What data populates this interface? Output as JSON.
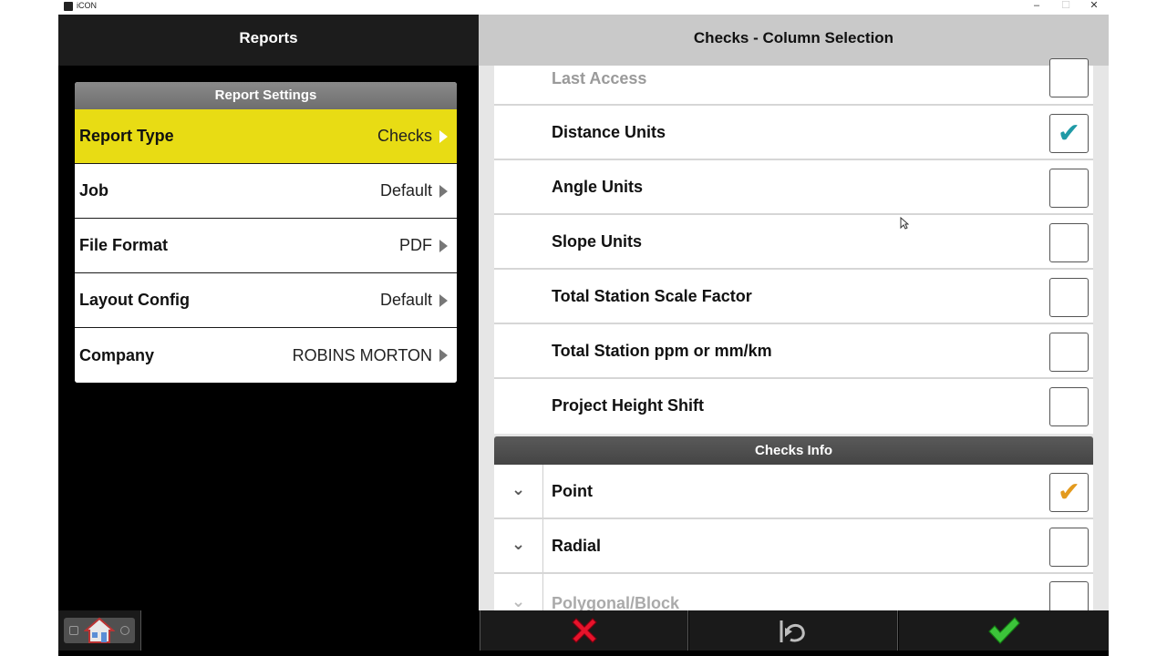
{
  "window": {
    "title": "iCON",
    "minimize": "–",
    "maximize": "☐",
    "close": "✕"
  },
  "left": {
    "header": "Reports",
    "settings_title": "Report Settings",
    "rows": [
      {
        "label": "Report Type",
        "value": "Checks",
        "active": true
      },
      {
        "label": "Job",
        "value": "Default",
        "active": false
      },
      {
        "label": "File Format",
        "value": "PDF",
        "active": false
      },
      {
        "label": "Layout Config",
        "value": "Default",
        "active": false
      },
      {
        "label": "Company",
        "value": "ROBINS MORTON",
        "active": false
      }
    ]
  },
  "right": {
    "header": "Checks - Column Selection",
    "columns": [
      {
        "label": "Last Access",
        "checked": false
      },
      {
        "label": "Distance Units",
        "checked": true
      },
      {
        "label": "Angle Units",
        "checked": false
      },
      {
        "label": "Slope Units",
        "checked": false
      },
      {
        "label": "Total Station Scale Factor",
        "checked": false
      },
      {
        "label": "Total Station ppm or mm/km",
        "checked": false
      },
      {
        "label": "Project Height Shift",
        "checked": false
      }
    ],
    "section_title": "Checks Info",
    "info_rows": [
      {
        "label": "Point",
        "checked": true
      },
      {
        "label": "Radial",
        "checked": false
      },
      {
        "label": "Polygonal/Block",
        "checked": false
      }
    ],
    "expander_glyph": "⌄",
    "check_glyph": "✔"
  },
  "colors": {
    "active_row": "#e8dc14",
    "check_teal": "#1f9aa6",
    "check_orange": "#e39a1d",
    "cancel_red": "#e8132b",
    "ok_green": "#3cc43a"
  },
  "toolbar": {
    "icons": [
      "home-icon",
      "cancel-icon",
      "undo-icon",
      "confirm-icon"
    ]
  }
}
